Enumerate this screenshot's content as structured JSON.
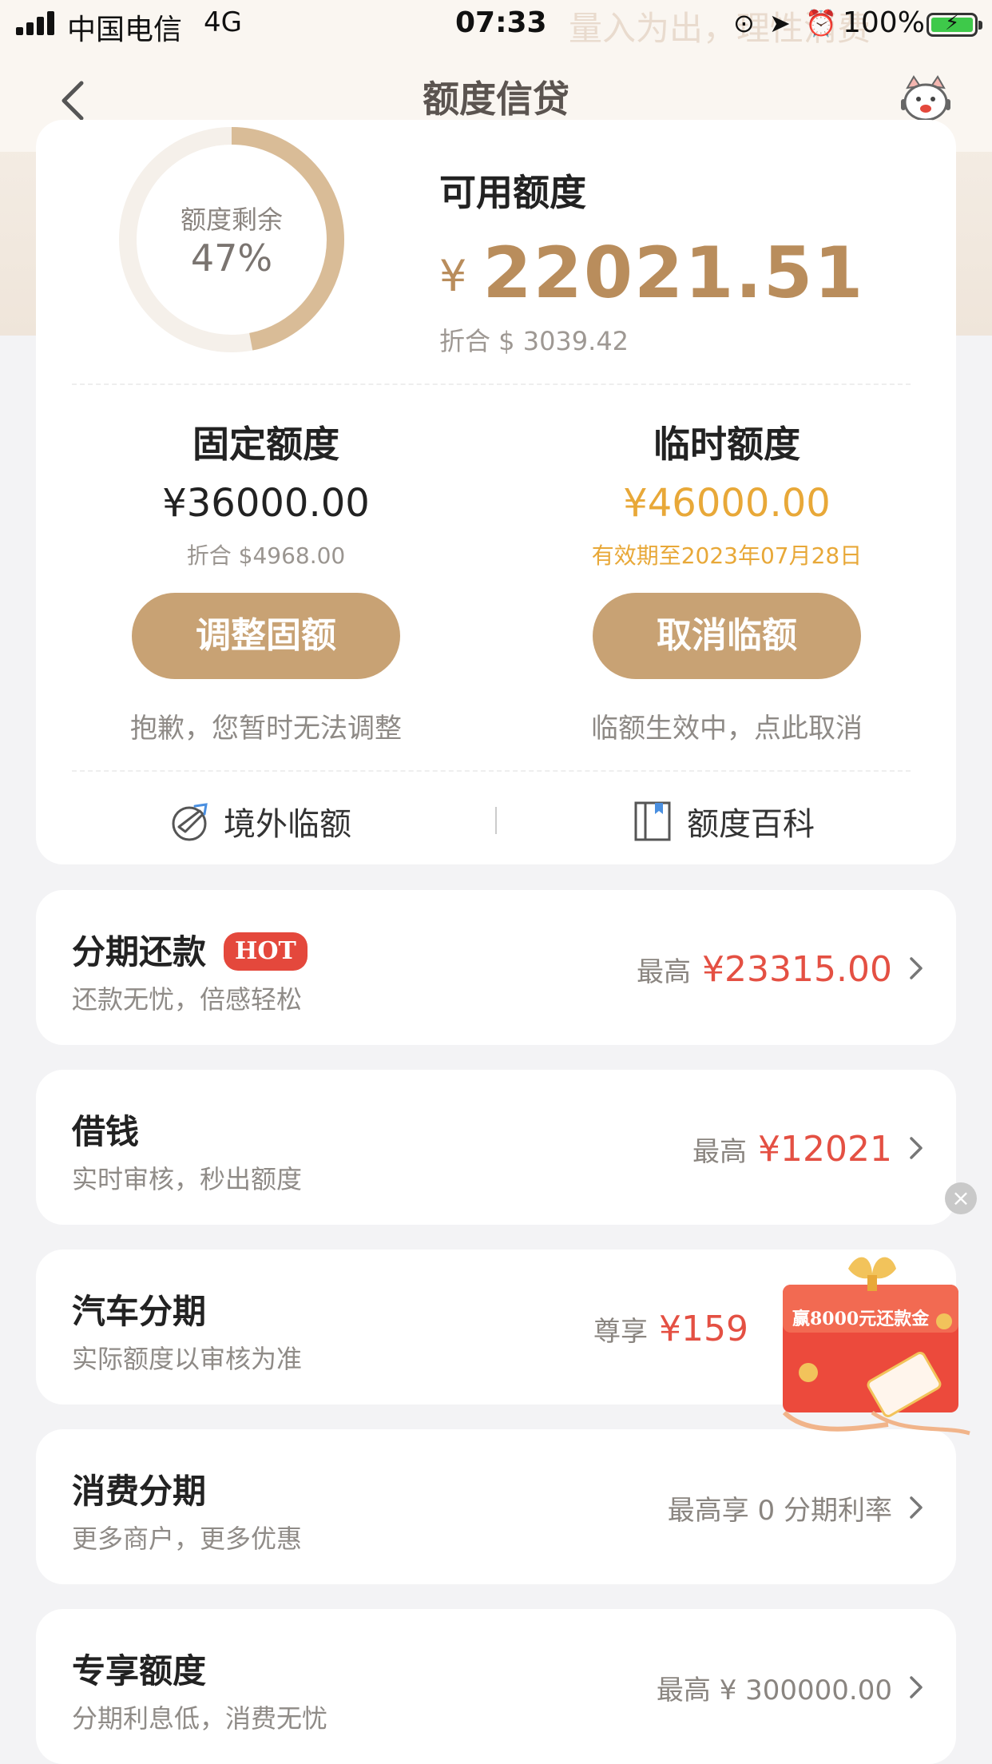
{
  "status_bar": {
    "carrier": "中国电信",
    "network": "4G",
    "time": "07:33",
    "ghost_text": "量入为出，理性消费",
    "battery": "100%",
    "battery_level": 1.0
  },
  "nav": {
    "title": "额度信贷",
    "back_icon": "chevron-left-icon",
    "mascot_icon": "cat-mascot-icon"
  },
  "overview": {
    "ring_label": "额度剩余",
    "ring_value": "47%",
    "ring_fraction": 0.47,
    "available_title": "可用额度",
    "currency_symbol": "¥",
    "available_amount": "22021.51",
    "fx_text": "折合 $ 3039.42"
  },
  "fixed": {
    "title": "固定额度",
    "amount": "¥36000.00",
    "sub": "折合 $4968.00",
    "button": "调整固额",
    "note": "抱歉，您暂时无法调整"
  },
  "temp": {
    "title": "临时额度",
    "amount": "¥46000.00",
    "sub": "有效期至2023年07月28日",
    "button": "取消临额",
    "note": "临额生效中，点此取消"
  },
  "links": {
    "overseas": "境外临额",
    "wiki": "额度百科"
  },
  "rows": [
    {
      "title": "分期还款",
      "badge": "HOT",
      "sub": "还款无忧，倍感轻松",
      "prefix": "最高",
      "value": "¥23315.00"
    },
    {
      "title": "借钱",
      "sub": "实时审核，秒出额度",
      "prefix": "最高",
      "value": "¥12021"
    },
    {
      "title": "汽车分期",
      "sub": "实际额度以审核为准",
      "prefix": "尊享",
      "value": "¥159"
    },
    {
      "title": "消费分期",
      "sub": "更多商户，更多优惠",
      "plain": "最高享 0 分期利率"
    },
    {
      "title": "专享额度",
      "sub": "分期利息低，消费无忧",
      "plain": "最高 ¥ 300000.00"
    }
  ],
  "promo": {
    "text": "赢8000元还款金",
    "close": "×"
  },
  "colors": {
    "gold": "#c8a274",
    "gold_text": "#b98d5c",
    "orange": "#e8a838",
    "red": "#e45043"
  }
}
